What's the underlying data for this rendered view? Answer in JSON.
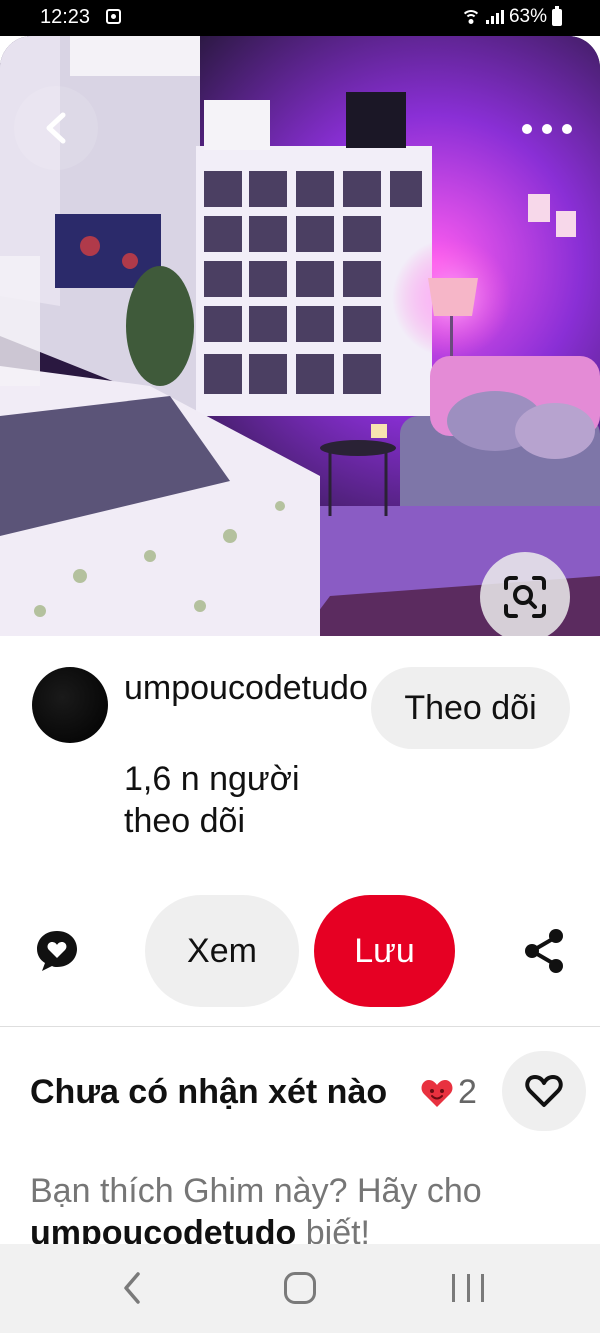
{
  "status_bar": {
    "time": "12:23",
    "battery_percent": "63%",
    "icons": [
      "notification-icon",
      "wifi-icon",
      "signal-icon",
      "battery-icon"
    ]
  },
  "hero": {
    "image_subject": "bedroom-purple-lighting-photo",
    "controls": {
      "back_icon": "chevron-left-icon",
      "more_icon": "more-horizontal-icon",
      "visual_search_icon": "lens-search-icon"
    }
  },
  "creator": {
    "name": "umpoucodetudo",
    "followers": "1,6 n người theo dõi",
    "follow_label": "Theo dõi"
  },
  "actions": {
    "comment_icon": "comment-heart-icon",
    "view_label": "Xem",
    "save_label": "Lưu",
    "share_icon": "share-icon"
  },
  "comments": {
    "title": "Chưa có nhận xét nào",
    "reaction_icon": "heart-face-emoji",
    "reaction_count": "2",
    "like_icon": "heart-outline-icon",
    "prompt_prefix": "Bạn thích Ghim này? Hãy cho ",
    "prompt_user": "umpoucodetudo",
    "prompt_suffix": " biết!"
  },
  "nav_bar": {
    "icons": [
      "back-icon",
      "home-icon",
      "recent-apps-icon"
    ]
  },
  "colors": {
    "accent": "#e60023",
    "button_bg": "#efefef",
    "muted_text": "#767676"
  }
}
